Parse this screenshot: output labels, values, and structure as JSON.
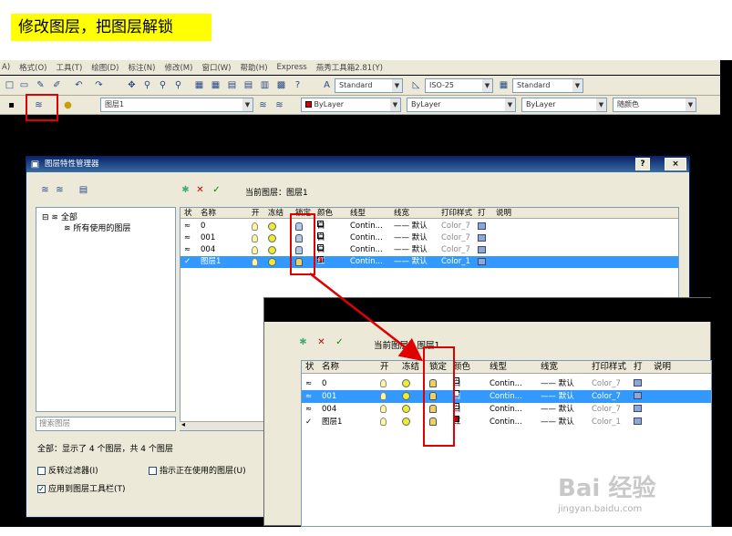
{
  "banner": "修改图层，把图层解锁",
  "menubar": [
    "A)",
    "格式(O)",
    "工具(T)",
    "绘图(D)",
    "标注(N)",
    "修改(M)",
    "窗口(W)",
    "帮助(H)",
    "Express",
    "燕秀工具箱2.81(Y)"
  ],
  "toolbar": {
    "text_style": "Standard",
    "dim_style": "ISO-25",
    "table_style": "Standard",
    "layer_combo": "图层1",
    "color_combo": "ByLayer",
    "linetype_combo": "ByLayer",
    "lineweight_combo": "ByLayer",
    "plotstyle_combo": "随颜色"
  },
  "dialog": {
    "title": "图层特性管理器",
    "help_btn": "?",
    "close_btn": "×",
    "current_layer_label": "当前图层：图层1",
    "tree": {
      "root": "全部",
      "child": "所有使用的图层"
    },
    "search_placeholder": "搜索图层",
    "status": "全部：显示了 4 个图层，共 4 个图层",
    "opt_invert": "反转过滤器(I)",
    "opt_indicate": "指示正在使用的图层(U)",
    "opt_apply": "应用到图层工具栏(T)",
    "columns": [
      "状",
      "名称",
      "开",
      "冻结",
      "锁定",
      "颜色",
      "线型",
      "线宽",
      "打印样式",
      "打",
      "说明"
    ],
    "layers": [
      {
        "name": "0",
        "color": "白",
        "linetype": "Contin...",
        "lineweight": "—— 默认",
        "plotstyle": "Color_7",
        "locked": true,
        "selected": false
      },
      {
        "name": "001",
        "color": "白",
        "linetype": "Contin...",
        "lineweight": "—— 默认",
        "plotstyle": "Color_7",
        "locked": true,
        "selected": false
      },
      {
        "name": "004",
        "color": "白",
        "linetype": "Contin...",
        "lineweight": "—— 默认",
        "plotstyle": "Color_7",
        "locked": true,
        "selected": false
      },
      {
        "name": "图层1",
        "color": "红",
        "linetype": "Contin...",
        "lineweight": "—— 默认",
        "plotstyle": "Color_1",
        "locked": false,
        "selected": true
      }
    ]
  },
  "zoom": {
    "current_layer_label": "当前图层：图层1",
    "columns": [
      "状",
      "名称",
      "开",
      "冻结",
      "锁定",
      "颜色",
      "线型",
      "线宽",
      "打印样式",
      "打",
      "说明"
    ],
    "layers": [
      {
        "name": "0",
        "color": "白",
        "linetype": "Contin...",
        "lineweight": "—— 默认",
        "plotstyle": "Color_7",
        "selected": false
      },
      {
        "name": "001",
        "color": "白",
        "linetype": "Contin...",
        "lineweight": "—— 默认",
        "plotstyle": "Color_7",
        "selected": true
      },
      {
        "name": "004",
        "color": "白",
        "linetype": "Contin...",
        "lineweight": "—— 默认",
        "plotstyle": "Color_7",
        "selected": false
      },
      {
        "name": "图层1",
        "color": "红",
        "linetype": "Contin...",
        "lineweight": "—— 默认",
        "plotstyle": "Color_1",
        "selected": false
      }
    ]
  },
  "watermark": {
    "logo": "Bai 经验",
    "url": "jingyan.baidu.com"
  },
  "colors": {
    "highlight": "#e00000",
    "selection": "#3399ff",
    "banner": "#ffff00"
  }
}
